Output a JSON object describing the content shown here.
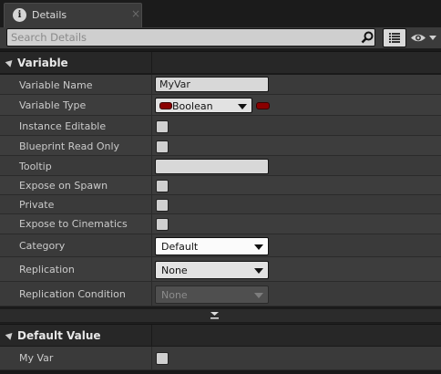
{
  "tab": {
    "title": "Details",
    "close_glyph": "×",
    "icon": "info-icon",
    "icon_glyph": "i"
  },
  "search": {
    "placeholder": "Search Details",
    "value": ""
  },
  "toolbar": {
    "list_view_icon": "list-view-icon",
    "visibility_icon": "eye-icon"
  },
  "sections": {
    "variable": {
      "title": "Variable",
      "props": {
        "variable_name": {
          "label": "Variable Name",
          "value": "MyVar"
        },
        "variable_type": {
          "label": "Variable Type",
          "value": "Boolean",
          "pin_color": "#8b0000"
        },
        "instance_editable": {
          "label": "Instance Editable",
          "checked": false
        },
        "blueprint_read_only": {
          "label": "Blueprint Read Only",
          "checked": false
        },
        "tooltip": {
          "label": "Tooltip",
          "value": ""
        },
        "expose_on_spawn": {
          "label": "Expose on Spawn",
          "checked": false
        },
        "private": {
          "label": "Private",
          "checked": false
        },
        "expose_to_cinematics": {
          "label": "Expose to Cinematics",
          "checked": false
        },
        "category": {
          "label": "Category",
          "value": "Default"
        },
        "replication": {
          "label": "Replication",
          "value": "None"
        },
        "replication_condition": {
          "label": "Replication Condition",
          "value": "None",
          "enabled": false
        }
      }
    },
    "default_value": {
      "title": "Default Value",
      "props": {
        "my_var": {
          "label": "My Var",
          "checked": false
        }
      }
    }
  }
}
